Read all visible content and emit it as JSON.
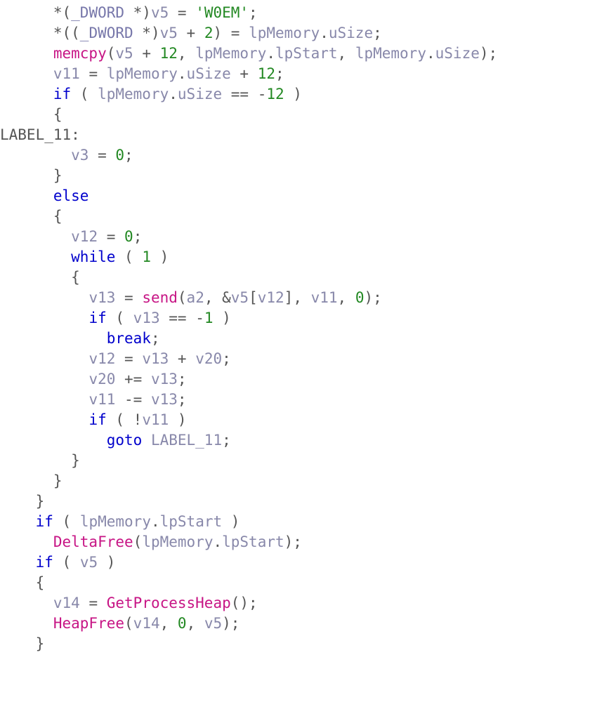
{
  "code": {
    "lines": [
      {
        "indent": 3,
        "tokens": [
          {
            "t": "*(",
            "c": "punct"
          },
          {
            "t": "_DWORD",
            "c": "type"
          },
          {
            "t": " *)",
            "c": "punct"
          },
          {
            "t": "v5",
            "c": "var"
          },
          {
            "t": " = ",
            "c": "punct"
          },
          {
            "t": "'W0EM'",
            "c": "str"
          },
          {
            "t": ";",
            "c": "punct"
          }
        ]
      },
      {
        "indent": 3,
        "tokens": [
          {
            "t": "*((",
            "c": "punct"
          },
          {
            "t": "_DWORD",
            "c": "type"
          },
          {
            "t": " *)",
            "c": "punct"
          },
          {
            "t": "v5",
            "c": "var"
          },
          {
            "t": " + ",
            "c": "punct"
          },
          {
            "t": "2",
            "c": "num"
          },
          {
            "t": ") = ",
            "c": "punct"
          },
          {
            "t": "lpMemory",
            "c": "var"
          },
          {
            "t": ".",
            "c": "punct"
          },
          {
            "t": "uSize",
            "c": "mem"
          },
          {
            "t": ";",
            "c": "punct"
          }
        ]
      },
      {
        "indent": 3,
        "tokens": [
          {
            "t": "memcpy",
            "c": "fn"
          },
          {
            "t": "(",
            "c": "punct"
          },
          {
            "t": "v5",
            "c": "var"
          },
          {
            "t": " + ",
            "c": "punct"
          },
          {
            "t": "12",
            "c": "num"
          },
          {
            "t": ", ",
            "c": "punct"
          },
          {
            "t": "lpMemory",
            "c": "var"
          },
          {
            "t": ".",
            "c": "punct"
          },
          {
            "t": "lpStart",
            "c": "mem"
          },
          {
            "t": ", ",
            "c": "punct"
          },
          {
            "t": "lpMemory",
            "c": "var"
          },
          {
            "t": ".",
            "c": "punct"
          },
          {
            "t": "uSize",
            "c": "mem"
          },
          {
            "t": ");",
            "c": "punct"
          }
        ]
      },
      {
        "indent": 3,
        "tokens": [
          {
            "t": "v11",
            "c": "var"
          },
          {
            "t": " = ",
            "c": "punct"
          },
          {
            "t": "lpMemory",
            "c": "var"
          },
          {
            "t": ".",
            "c": "punct"
          },
          {
            "t": "uSize",
            "c": "mem"
          },
          {
            "t": " + ",
            "c": "punct"
          },
          {
            "t": "12",
            "c": "num"
          },
          {
            "t": ";",
            "c": "punct"
          }
        ]
      },
      {
        "indent": 3,
        "tokens": [
          {
            "t": "if",
            "c": "kw"
          },
          {
            "t": " ( ",
            "c": "punct"
          },
          {
            "t": "lpMemory",
            "c": "var"
          },
          {
            "t": ".",
            "c": "punct"
          },
          {
            "t": "uSize",
            "c": "mem"
          },
          {
            "t": " == ",
            "c": "punct"
          },
          {
            "t": "-",
            "c": "punct"
          },
          {
            "t": "12",
            "c": "num"
          },
          {
            "t": " )",
            "c": "punct"
          }
        ]
      },
      {
        "indent": 3,
        "tokens": [
          {
            "t": "{",
            "c": "punct"
          }
        ]
      },
      {
        "indent": 0,
        "tokens": [
          {
            "t": "LABEL_11",
            "c": "lbl"
          },
          {
            "t": ":",
            "c": "punct"
          }
        ]
      },
      {
        "indent": 4,
        "tokens": [
          {
            "t": "v3",
            "c": "var"
          },
          {
            "t": " = ",
            "c": "punct"
          },
          {
            "t": "0",
            "c": "num"
          },
          {
            "t": ";",
            "c": "punct"
          }
        ]
      },
      {
        "indent": 3,
        "tokens": [
          {
            "t": "}",
            "c": "punct"
          }
        ]
      },
      {
        "indent": 3,
        "tokens": [
          {
            "t": "else",
            "c": "kw"
          }
        ]
      },
      {
        "indent": 3,
        "tokens": [
          {
            "t": "{",
            "c": "punct"
          }
        ]
      },
      {
        "indent": 4,
        "tokens": [
          {
            "t": "v12",
            "c": "var"
          },
          {
            "t": " = ",
            "c": "punct"
          },
          {
            "t": "0",
            "c": "num"
          },
          {
            "t": ";",
            "c": "punct"
          }
        ]
      },
      {
        "indent": 4,
        "tokens": [
          {
            "t": "while",
            "c": "kw"
          },
          {
            "t": " ( ",
            "c": "punct"
          },
          {
            "t": "1",
            "c": "num"
          },
          {
            "t": " )",
            "c": "punct"
          }
        ]
      },
      {
        "indent": 4,
        "tokens": [
          {
            "t": "{",
            "c": "punct"
          }
        ]
      },
      {
        "indent": 5,
        "tokens": [
          {
            "t": "v13",
            "c": "var"
          },
          {
            "t": " = ",
            "c": "punct"
          },
          {
            "t": "send",
            "c": "fn"
          },
          {
            "t": "(",
            "c": "punct"
          },
          {
            "t": "a2",
            "c": "var"
          },
          {
            "t": ", &",
            "c": "punct"
          },
          {
            "t": "v5",
            "c": "var"
          },
          {
            "t": "[",
            "c": "punct"
          },
          {
            "t": "v12",
            "c": "var"
          },
          {
            "t": "], ",
            "c": "punct"
          },
          {
            "t": "v11",
            "c": "var"
          },
          {
            "t": ", ",
            "c": "punct"
          },
          {
            "t": "0",
            "c": "num"
          },
          {
            "t": ");",
            "c": "punct"
          }
        ]
      },
      {
        "indent": 5,
        "tokens": [
          {
            "t": "if",
            "c": "kw"
          },
          {
            "t": " ( ",
            "c": "punct"
          },
          {
            "t": "v13",
            "c": "var"
          },
          {
            "t": " == ",
            "c": "punct"
          },
          {
            "t": "-",
            "c": "punct"
          },
          {
            "t": "1",
            "c": "num"
          },
          {
            "t": " )",
            "c": "punct"
          }
        ]
      },
      {
        "indent": 6,
        "tokens": [
          {
            "t": "break",
            "c": "kw"
          },
          {
            "t": ";",
            "c": "punct"
          }
        ]
      },
      {
        "indent": 5,
        "tokens": [
          {
            "t": "v12",
            "c": "var"
          },
          {
            "t": " = ",
            "c": "punct"
          },
          {
            "t": "v13",
            "c": "var"
          },
          {
            "t": " + ",
            "c": "punct"
          },
          {
            "t": "v20",
            "c": "var"
          },
          {
            "t": ";",
            "c": "punct"
          }
        ]
      },
      {
        "indent": 5,
        "tokens": [
          {
            "t": "v20",
            "c": "var"
          },
          {
            "t": " += ",
            "c": "punct"
          },
          {
            "t": "v13",
            "c": "var"
          },
          {
            "t": ";",
            "c": "punct"
          }
        ]
      },
      {
        "indent": 5,
        "tokens": [
          {
            "t": "v11",
            "c": "var"
          },
          {
            "t": " -= ",
            "c": "punct"
          },
          {
            "t": "v13",
            "c": "var"
          },
          {
            "t": ";",
            "c": "punct"
          }
        ]
      },
      {
        "indent": 5,
        "tokens": [
          {
            "t": "if",
            "c": "kw"
          },
          {
            "t": " ( !",
            "c": "punct"
          },
          {
            "t": "v11",
            "c": "var"
          },
          {
            "t": " )",
            "c": "punct"
          }
        ]
      },
      {
        "indent": 6,
        "tokens": [
          {
            "t": "goto",
            "c": "kw"
          },
          {
            "t": " ",
            "c": "punct"
          },
          {
            "t": "LABEL_11",
            "c": "var"
          },
          {
            "t": ";",
            "c": "punct"
          }
        ]
      },
      {
        "indent": 4,
        "tokens": [
          {
            "t": "}",
            "c": "punct"
          }
        ]
      },
      {
        "indent": 3,
        "tokens": [
          {
            "t": "}",
            "c": "punct"
          }
        ]
      },
      {
        "indent": 2,
        "tokens": [
          {
            "t": "}",
            "c": "punct"
          }
        ]
      },
      {
        "indent": 2,
        "tokens": [
          {
            "t": "if",
            "c": "kw"
          },
          {
            "t": " ( ",
            "c": "punct"
          },
          {
            "t": "lpMemory",
            "c": "var"
          },
          {
            "t": ".",
            "c": "punct"
          },
          {
            "t": "lpStart",
            "c": "mem"
          },
          {
            "t": " )",
            "c": "punct"
          }
        ]
      },
      {
        "indent": 3,
        "tokens": [
          {
            "t": "DeltaFree",
            "c": "fn"
          },
          {
            "t": "(",
            "c": "punct"
          },
          {
            "t": "lpMemory",
            "c": "var"
          },
          {
            "t": ".",
            "c": "punct"
          },
          {
            "t": "lpStart",
            "c": "mem"
          },
          {
            "t": ");",
            "c": "punct"
          }
        ]
      },
      {
        "indent": 2,
        "tokens": [
          {
            "t": "if",
            "c": "kw"
          },
          {
            "t": " ( ",
            "c": "punct"
          },
          {
            "t": "v5",
            "c": "var"
          },
          {
            "t": " )",
            "c": "punct"
          }
        ]
      },
      {
        "indent": 2,
        "tokens": [
          {
            "t": "{",
            "c": "punct"
          }
        ]
      },
      {
        "indent": 3,
        "tokens": [
          {
            "t": "v14",
            "c": "var"
          },
          {
            "t": " = ",
            "c": "punct"
          },
          {
            "t": "GetProcessHeap",
            "c": "fn"
          },
          {
            "t": "();",
            "c": "punct"
          }
        ]
      },
      {
        "indent": 3,
        "tokens": [
          {
            "t": "HeapFree",
            "c": "fn"
          },
          {
            "t": "(",
            "c": "punct"
          },
          {
            "t": "v14",
            "c": "var"
          },
          {
            "t": ", ",
            "c": "punct"
          },
          {
            "t": "0",
            "c": "num"
          },
          {
            "t": ", ",
            "c": "punct"
          },
          {
            "t": "v5",
            "c": "var"
          },
          {
            "t": ");",
            "c": "punct"
          }
        ]
      },
      {
        "indent": 2,
        "tokens": [
          {
            "t": "}",
            "c": "punct"
          }
        ]
      }
    ]
  }
}
